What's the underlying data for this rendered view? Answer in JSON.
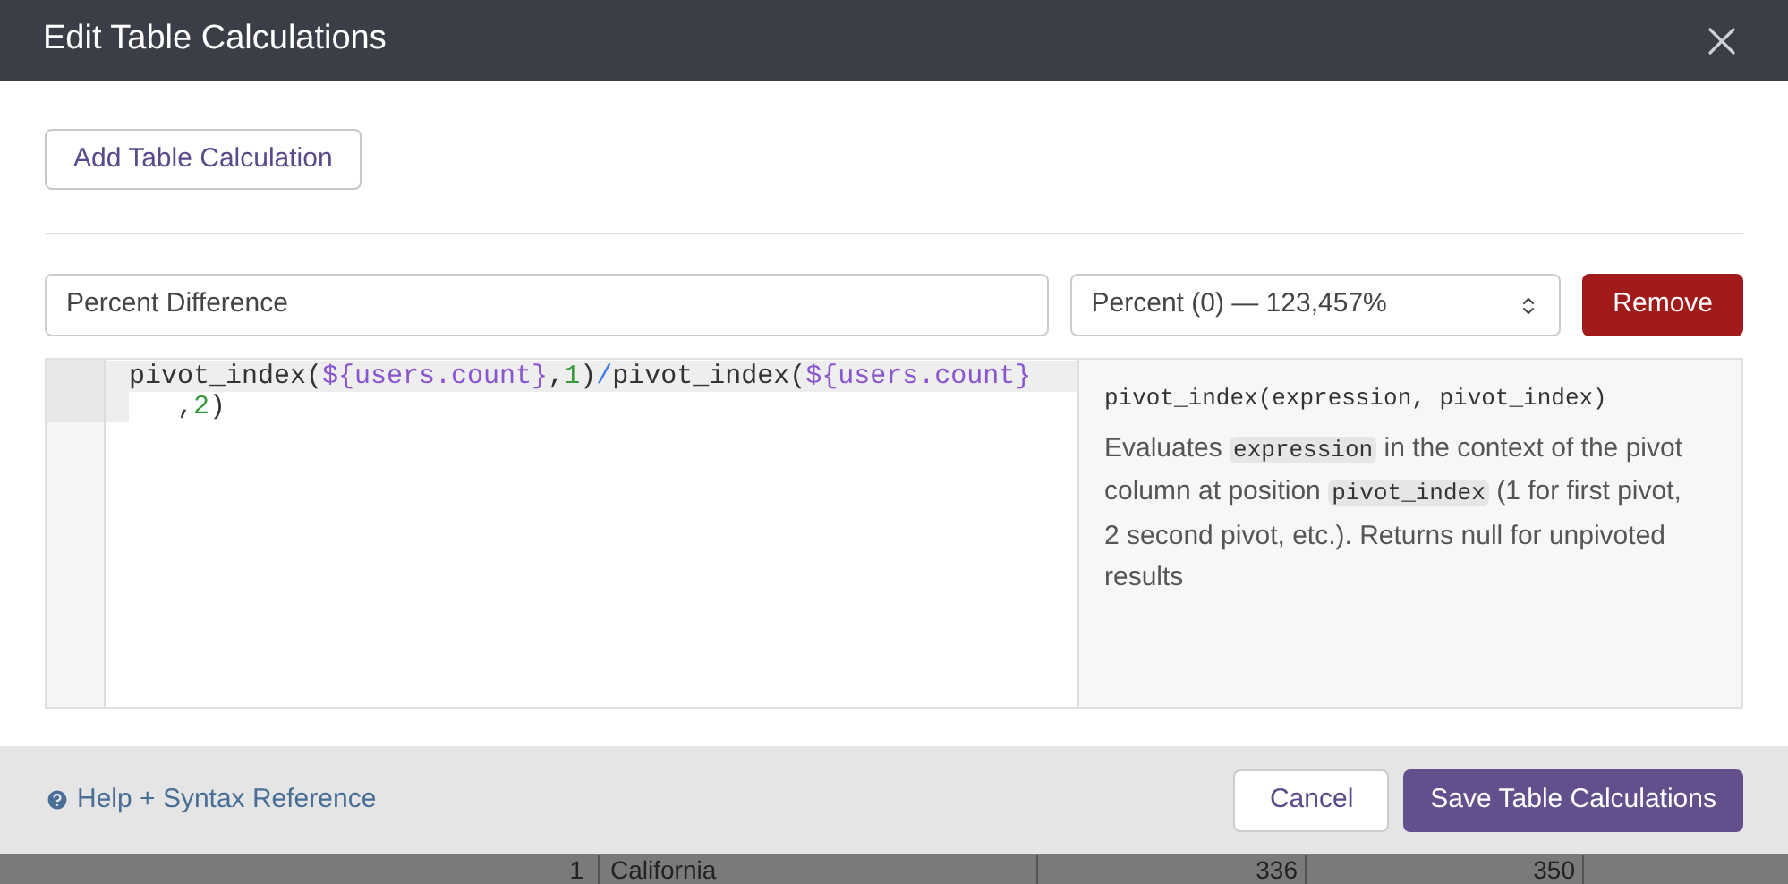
{
  "dialog": {
    "title": "Edit Table Calculations",
    "add_button": "Add Table Calculation",
    "calculation": {
      "name": "Percent Difference",
      "format": "Percent (0) — 123,457%",
      "remove_button": "Remove",
      "code_lines": [
        {
          "continuation": false,
          "tokens": [
            {
              "kind": "plain",
              "text": "pivot_index("
            },
            {
              "kind": "var",
              "text": "${users.count}"
            },
            {
              "kind": "plain",
              "text": ","
            },
            {
              "kind": "num",
              "text": "1"
            },
            {
              "kind": "plain",
              "text": ")"
            },
            {
              "kind": "op",
              "text": "/"
            },
            {
              "kind": "plain",
              "text": "pivot_index("
            },
            {
              "kind": "var",
              "text": "${users.count}"
            }
          ]
        },
        {
          "continuation": true,
          "tokens": [
            {
              "kind": "plain",
              "text": ","
            },
            {
              "kind": "num",
              "text": "2"
            },
            {
              "kind": "plain",
              "text": ")"
            }
          ]
        }
      ],
      "doc": {
        "signature": "pivot_index(expression, pivot_index)",
        "description": [
          {
            "kind": "text",
            "text": "Evaluates "
          },
          {
            "kind": "code",
            "text": "expression"
          },
          {
            "kind": "text",
            "text": " in the context of the pivot column at position "
          },
          {
            "kind": "code",
            "text": "pivot_index"
          },
          {
            "kind": "text",
            "text": " (1 for first pivot, 2 second pivot, etc.). Returns null for unpivoted results"
          }
        ]
      }
    },
    "help_link": "Help + Syntax Reference",
    "cancel_button": "Cancel",
    "save_button": "Save Table Calculations"
  },
  "background_table": {
    "row": [
      "1",
      "California",
      "336",
      "350"
    ]
  }
}
